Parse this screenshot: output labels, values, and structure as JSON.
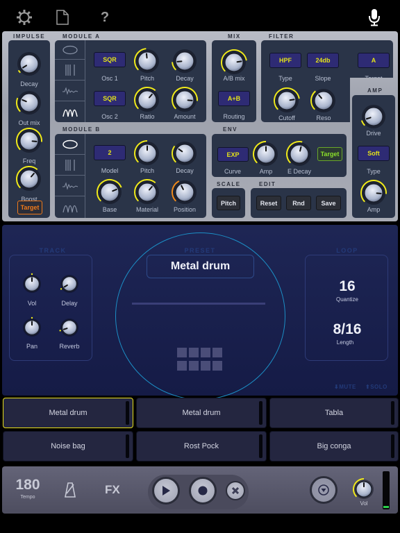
{
  "topbar": {
    "icons": [
      "gear-icon",
      "document-icon",
      "help-icon",
      "microphone-icon"
    ],
    "help_glyph": "?"
  },
  "impulse": {
    "title": "IMPULSE",
    "knobs": [
      {
        "label": "Decay",
        "value": 0.05
      },
      {
        "label": "Out mix",
        "value": 0.25
      },
      {
        "label": "Freq",
        "value": 0.85
      },
      {
        "label": "Boost",
        "value": 0.65
      }
    ],
    "target_label": "Target",
    "target_color": "#f07a1a"
  },
  "module_a": {
    "title": "MODULE A",
    "waveforms": [
      "ellipse",
      "bars",
      "noise",
      "wave"
    ],
    "osc1": {
      "value": "SQR",
      "label": "Osc 1"
    },
    "osc2": {
      "value": "SQR",
      "label": "Osc 2"
    },
    "knobs": [
      {
        "label": "Pitch",
        "value": 0.48
      },
      {
        "label": "Decay",
        "value": 0.15
      },
      {
        "label": "Ratio",
        "value": 0.65
      },
      {
        "label": "Amount",
        "value": 0.85
      }
    ]
  },
  "module_b": {
    "title": "MODULE B",
    "waveforms": [
      "ellipse",
      "bars",
      "noise",
      "wave"
    ],
    "model": {
      "value": "2",
      "label": "Model"
    },
    "knobs": [
      {
        "label": "Pitch",
        "value": 0.5
      },
      {
        "label": "Decay",
        "value": 0.3
      },
      {
        "label": "Base",
        "value": 0.75
      },
      {
        "label": "Material",
        "value": 0.65
      },
      {
        "label": "Position",
        "value": 0.4
      }
    ]
  },
  "mix": {
    "title": "MIX",
    "knob": {
      "label": "A/B mix",
      "value": 0.8
    },
    "routing": {
      "value": "A+B",
      "label": "Routing"
    }
  },
  "filter": {
    "title": "FILTER",
    "type": {
      "value": "HPF",
      "label": "Type"
    },
    "slope": {
      "value": "24db",
      "label": "Slope"
    },
    "target": {
      "value": "A",
      "label": "Target"
    },
    "knobs": [
      {
        "label": "Cutoff",
        "value": 0.8
      },
      {
        "label": "Reso",
        "value": 0.35
      }
    ]
  },
  "amp": {
    "title": "AMP",
    "drive": {
      "label": "Drive",
      "value": 0.1
    },
    "type": {
      "value": "Soft",
      "label": "Type"
    },
    "amp": {
      "label": "Amp",
      "value": 0.85
    }
  },
  "env": {
    "title": "ENV",
    "curve": {
      "value": "EXP",
      "label": "Curve"
    },
    "knobs": [
      {
        "label": "Amp",
        "value": 0.5
      },
      {
        "label": "E Decay",
        "value": 0.55
      }
    ],
    "target_label": "Target",
    "target_color": "#8be02a"
  },
  "scale": {
    "title": "SCALE",
    "button": "Pitch"
  },
  "edit": {
    "title": "EDIT",
    "buttons": [
      "Reset",
      "Rnd",
      "Save"
    ]
  },
  "track": {
    "title": "TRACK",
    "knobs": [
      {
        "label": "Vol",
        "value": 0.5
      },
      {
        "label": "Delay",
        "value": 0.05
      },
      {
        "label": "Pan",
        "value": 0.5
      },
      {
        "label": "Reverb",
        "value": 0.1
      }
    ]
  },
  "preset": {
    "title": "PRESET",
    "name": "Metal drum",
    "step_pads": 8
  },
  "loop": {
    "title": "LOOP",
    "quantize_value": "16",
    "quantize_label": "Quantize",
    "length_value": "8/16",
    "length_label": "Length"
  },
  "mute_solo_hint": {
    "mute": "⬇MUTE",
    "solo": "⬆SOLO"
  },
  "pads": [
    {
      "label": "Metal drum",
      "selected": true
    },
    {
      "label": "Metal drum",
      "selected": false
    },
    {
      "label": "Tabla",
      "selected": false
    },
    {
      "label": "Noise bag",
      "selected": false
    },
    {
      "label": "Rost Pock",
      "selected": false
    },
    {
      "label": "Big conga",
      "selected": false
    }
  ],
  "transport": {
    "tempo_value": "180",
    "tempo_label": "Tempo",
    "fx_label": "FX",
    "vol_label": "Vol",
    "vol_value": 0.5,
    "output_level": 0.05
  },
  "colors": {
    "accent_yellow": "#f0ea1a",
    "selected_pad_border": "#e8e01a",
    "preset_circle": "#1c8fc6"
  }
}
